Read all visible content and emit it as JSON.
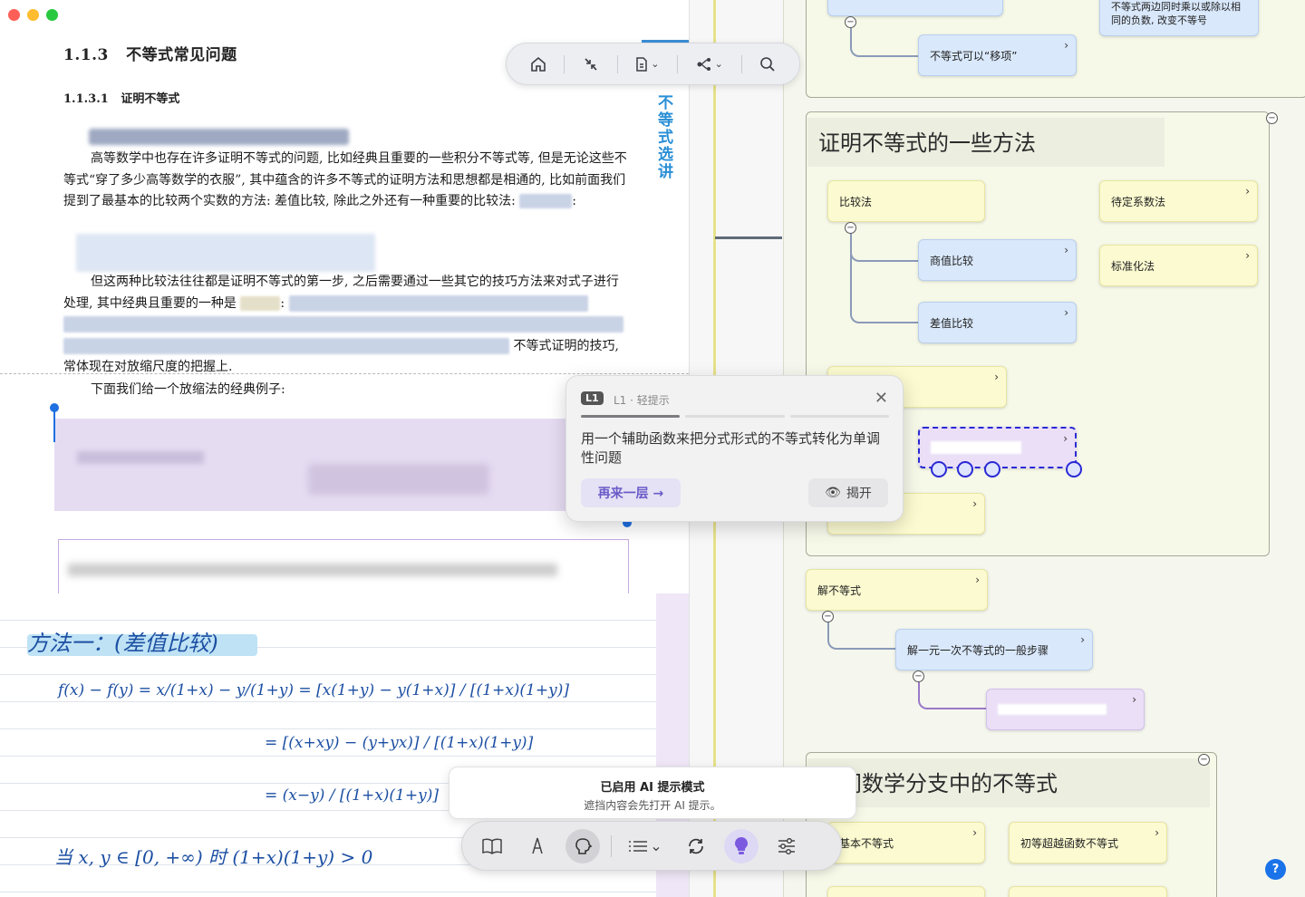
{
  "document": {
    "section_title": "1.1.3   不等式常见问题",
    "subsection_title": "1.1.3.1   证明不等式",
    "para1": "高等数学中也存在许多证明不等式的问题, 比如经典且重要的一些积分不等式等, 但是无论这些不等式“穿了多少高等数学的衣服”, 其中蕴含的许多不等式的证明方法和思想都是相通的, 比如前面我们提到了最基本的比较两个实数的方法: 差值比较, 除此之外还有一种重要的比较法:",
    "para2a": "但这两种比较法往往都是证明不等式的第一步, 之后需要通过一些其它的技巧方法来对式子进行处理, 其中经典且重要的一种是",
    "para2b": "不等式证明的技巧,",
    "para2c": "常体现在对放缩尺度的把握上.",
    "para3": "下面我们给一个放缩法的经典例子:",
    "side_label": "不等式选讲"
  },
  "top_toolbar": {
    "icons": [
      "home-icon",
      "collapse-icon",
      "document-icon",
      "mindmap-icon",
      "search-icon"
    ]
  },
  "handwriting": {
    "line1": "方法一：(差值比较)",
    "line2": "f(x) − f(y) = x/(1+x) − y/(1+y) = [x(1+y) − y(1+x)] / [(1+x)(1+y)]",
    "line3": "= [(x+xy) − (y+yx)] / [(1+x)(1+y)]",
    "line4": "= (x−y) / [(1+x)(1+y)]",
    "line5": "当 x, y ∈ [0, +∞) 时  (1+x)(1+y) > 0"
  },
  "hint": {
    "badge": "L1",
    "level": "L1 · 轻提示",
    "text": "用一个辅助函数来把分式形式的不等式转化为单调性问题",
    "more_label": "再来一层 →",
    "reveal_label": "揭开",
    "progress": [
      1,
      0,
      0
    ]
  },
  "toast": {
    "title": "已启用 AI 提示模式",
    "subtitle": "遮挡内容会先打开 AI 提示。"
  },
  "mindmap": {
    "top_node": "不等式可以“移项”",
    "top_right_node": "不等式两边同时乘以或除以相同的负数, 改变不等号",
    "group1_title": "证明不等式的一些方法",
    "nodes_group1": [
      "比较法",
      "商值比较",
      "差值比较",
      "待定系数法",
      "标准化法"
    ],
    "solve_node": "解不等式",
    "solve_child": "解一元一次不等式的一般步骤",
    "group2_title": "不同数学分支中的不等式",
    "nodes_group2": [
      "基本不等式",
      "初等超越函数不等式"
    ],
    "help": "?"
  },
  "colors": {
    "accent_blue": "#2a8fd6",
    "hint_purple": "#6a5ac8",
    "handwriting_blue": "#1c4fa3"
  }
}
